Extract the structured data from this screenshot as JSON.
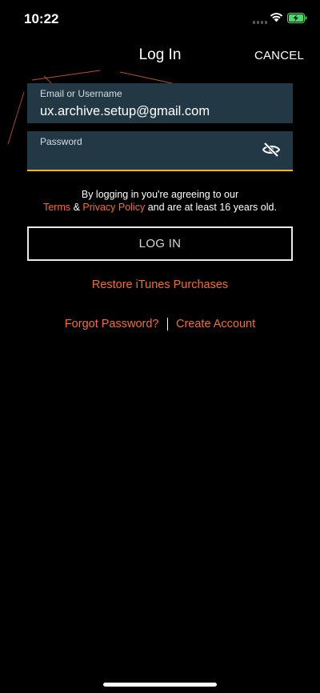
{
  "status": {
    "time": "10:22"
  },
  "nav": {
    "title": "Log In",
    "cancel_label": "CANCEL"
  },
  "email": {
    "label": "Email or Username",
    "value": "ux.archive.setup@gmail.com"
  },
  "password": {
    "label": "Password",
    "value": ""
  },
  "agreement": {
    "line1": "By logging in you're agreeing to our",
    "terms": "Terms",
    "amp": "&",
    "privacy": "Privacy Policy",
    "suffix": "and are at least 16 years old."
  },
  "login_label": "LOG IN",
  "restore_label": "Restore iTunes Purchases",
  "forgot_label": "Forgot Password?",
  "create_label": "Create Account",
  "icons": [
    "signal-icon",
    "wifi-icon",
    "battery-charging-icon",
    "eye-off-icon"
  ],
  "colors": {
    "accent": "#f26f32",
    "field_bg": "#223844",
    "focus_underline": "#f2b51b",
    "battery": "#4cd964"
  }
}
